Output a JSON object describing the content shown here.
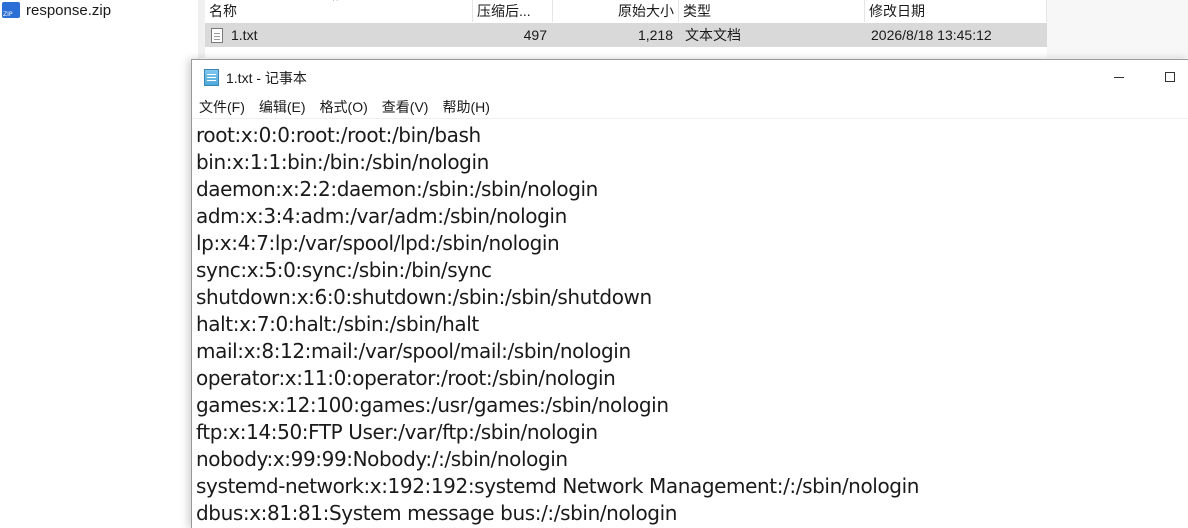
{
  "archive": {
    "tree_item": "response.zip",
    "columns": {
      "name": "名称",
      "compressed": "压缩后...",
      "original": "原始大小",
      "type": "类型",
      "modified": "修改日期"
    },
    "file": {
      "name": "1.txt",
      "compressed": "497",
      "original": "1,218",
      "type": "文本文档",
      "modified": "2026/8/18 13:45:12"
    },
    "sort_indicator": "^"
  },
  "notepad": {
    "title": "1.txt - 记事本",
    "menu": [
      "文件(F)",
      "编辑(E)",
      "格式(O)",
      "查看(V)",
      "帮助(H)"
    ],
    "lines": [
      "root:x:0:0:root:/root:/bin/bash",
      "bin:x:1:1:bin:/bin:/sbin/nologin",
      "daemon:x:2:2:daemon:/sbin:/sbin/nologin",
      "adm:x:3:4:adm:/var/adm:/sbin/nologin",
      "lp:x:4:7:lp:/var/spool/lpd:/sbin/nologin",
      "sync:x:5:0:sync:/sbin:/bin/sync",
      "shutdown:x:6:0:shutdown:/sbin:/sbin/shutdown",
      "halt:x:7:0:halt:/sbin:/sbin/halt",
      "mail:x:8:12:mail:/var/spool/mail:/sbin/nologin",
      "operator:x:11:0:operator:/root:/sbin/nologin",
      "games:x:12:100:games:/usr/games:/sbin/nologin",
      "ftp:x:14:50:FTP User:/var/ftp:/sbin/nologin",
      "nobody:x:99:99:Nobody:/:/sbin/nologin",
      "systemd-network:x:192:192:systemd Network Management:/:/sbin/nologin",
      "dbus:x:81:81:System message bus:/:/sbin/nologin"
    ]
  },
  "icons": {
    "zip": "zip-file-icon",
    "txt": "text-file-icon",
    "notepad": "notepad-icon",
    "minimize": "minimize-icon",
    "maximize": "maximize-icon"
  }
}
